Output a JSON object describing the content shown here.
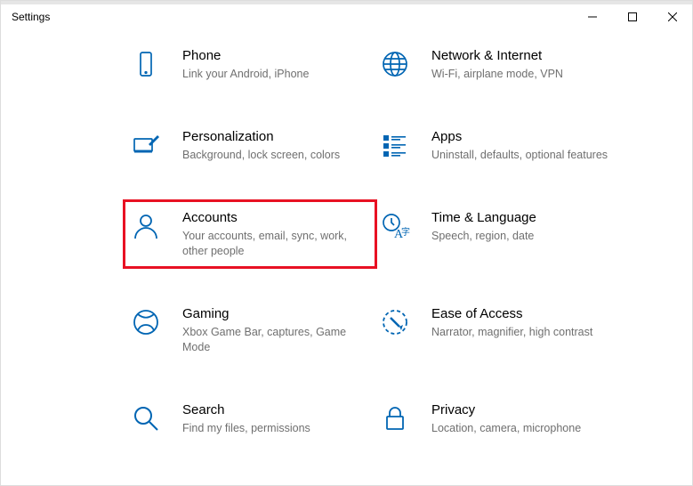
{
  "window": {
    "title": "Settings"
  },
  "tiles": {
    "phone": {
      "title": "Phone",
      "desc": "Link your Android, iPhone"
    },
    "network": {
      "title": "Network & Internet",
      "desc": "Wi-Fi, airplane mode, VPN"
    },
    "personalization": {
      "title": "Personalization",
      "desc": "Background, lock screen, colors"
    },
    "apps": {
      "title": "Apps",
      "desc": "Uninstall, defaults, optional features"
    },
    "accounts": {
      "title": "Accounts",
      "desc": "Your accounts, email, sync, work, other people"
    },
    "time": {
      "title": "Time & Language",
      "desc": "Speech, region, date"
    },
    "gaming": {
      "title": "Gaming",
      "desc": "Xbox Game Bar, captures, Game Mode"
    },
    "ease": {
      "title": "Ease of Access",
      "desc": "Narrator, magnifier, high contrast"
    },
    "search": {
      "title": "Search",
      "desc": "Find my files, permissions"
    },
    "privacy": {
      "title": "Privacy",
      "desc": "Location, camera, microphone"
    }
  }
}
